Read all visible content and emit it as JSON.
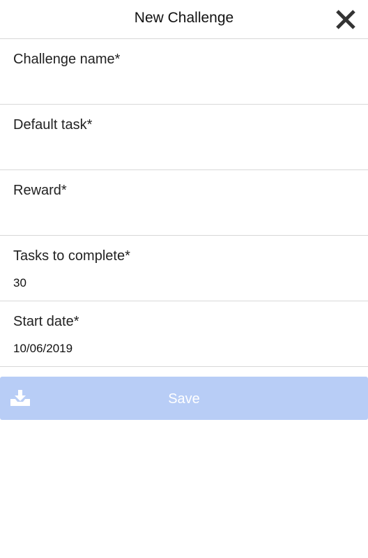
{
  "header": {
    "title": "New Challenge",
    "close_icon": "close-icon"
  },
  "form": {
    "fields": [
      {
        "label": "Challenge name*",
        "value": ""
      },
      {
        "label": "Default task*",
        "value": ""
      },
      {
        "label": "Reward*",
        "value": ""
      },
      {
        "label": "Tasks to complete*",
        "value": "30"
      },
      {
        "label": "Start date*",
        "value": "10/06/2019"
      }
    ]
  },
  "save_button": {
    "label": "Save",
    "icon": "download-tray-icon",
    "background_color": "#b8cdf6"
  }
}
